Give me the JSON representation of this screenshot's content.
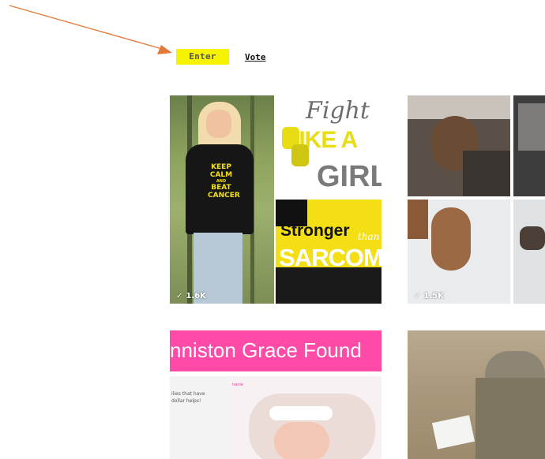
{
  "nav": {
    "enter_label": "Enter",
    "vote_label": "Vote"
  },
  "colors": {
    "highlight": "#f5f300",
    "arrow": "#e37a3a",
    "pink": "#ff4aa8",
    "sarcoma_yellow": "#f3df14"
  },
  "cards": [
    {
      "count": "1.6K",
      "shirt_lines": [
        "KEEP",
        "CALM",
        "AND",
        "BEAT",
        "CANCER"
      ],
      "fight_lines": [
        "Fight",
        "LIKE A",
        "GIRL"
      ],
      "stronger_lines": [
        "Stronger",
        "than",
        "SARCOMA"
      ]
    },
    {
      "count": "1.5K"
    },
    {
      "header_text": "nniston Grace Found",
      "side_text": "ilies that have\n dollar helps!",
      "tag": "nanie"
    },
    {}
  ],
  "icons": {
    "check": "check-icon",
    "arrow": "annotation-arrow"
  }
}
